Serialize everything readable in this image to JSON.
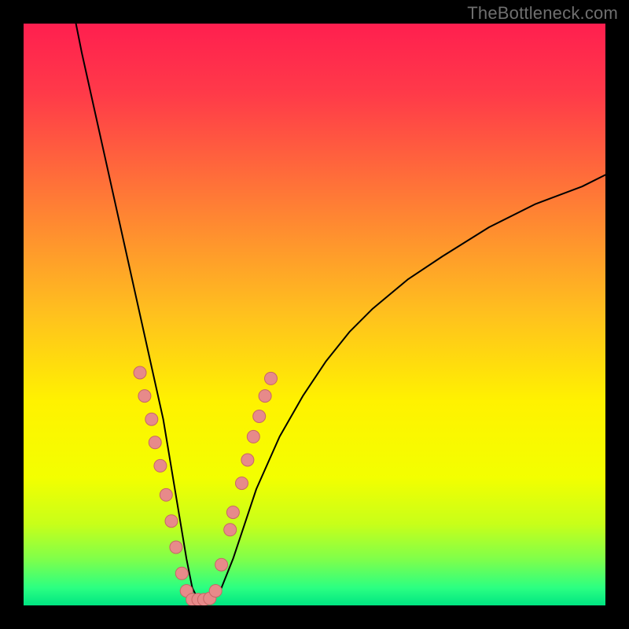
{
  "watermark": "TheBottleneck.com",
  "chart_data": {
    "type": "line",
    "title": "",
    "xlabel": "",
    "ylabel": "",
    "xlim": [
      0,
      100
    ],
    "ylim": [
      0,
      100
    ],
    "grid": false,
    "legend": false,
    "background_gradient": {
      "stops": [
        {
          "offset": 0.0,
          "color": "#ff1f4f"
        },
        {
          "offset": 0.12,
          "color": "#ff3a49"
        },
        {
          "offset": 0.3,
          "color": "#ff7a36"
        },
        {
          "offset": 0.5,
          "color": "#ffc11e"
        },
        {
          "offset": 0.65,
          "color": "#fff200"
        },
        {
          "offset": 0.78,
          "color": "#f3ff00"
        },
        {
          "offset": 0.86,
          "color": "#c8ff19"
        },
        {
          "offset": 0.92,
          "color": "#80ff4a"
        },
        {
          "offset": 0.97,
          "color": "#2bff82"
        },
        {
          "offset": 1.0,
          "color": "#00e582"
        }
      ]
    },
    "series": [
      {
        "name": "bottleneck-curve",
        "stroke": "#000000",
        "stroke_width": 2,
        "x": [
          9,
          10,
          12,
          14,
          16,
          18,
          20,
          22,
          24,
          25,
          26,
          27,
          28,
          29,
          30,
          32,
          34,
          36,
          38,
          40,
          44,
          48,
          52,
          56,
          60,
          66,
          72,
          80,
          88,
          96,
          100
        ],
        "y": [
          100,
          95,
          86,
          77,
          68,
          59,
          50,
          41,
          32,
          26,
          20,
          14,
          8,
          3,
          1,
          1,
          3,
          8,
          14,
          20,
          29,
          36,
          42,
          47,
          51,
          56,
          60,
          65,
          69,
          72,
          74
        ]
      }
    ],
    "markers": {
      "name": "highlight-points",
      "fill": "#e78a8a",
      "stroke": "#c76666",
      "radius": 8,
      "points": [
        {
          "x": 20.0,
          "y": 40.0
        },
        {
          "x": 20.8,
          "y": 36.0
        },
        {
          "x": 22.0,
          "y": 32.0
        },
        {
          "x": 22.6,
          "y": 28.0
        },
        {
          "x": 23.5,
          "y": 24.0
        },
        {
          "x": 24.5,
          "y": 19.0
        },
        {
          "x": 25.4,
          "y": 14.5
        },
        {
          "x": 26.2,
          "y": 10.0
        },
        {
          "x": 27.2,
          "y": 5.5
        },
        {
          "x": 28.0,
          "y": 2.5
        },
        {
          "x": 29.0,
          "y": 1.0
        },
        {
          "x": 30.0,
          "y": 1.0
        },
        {
          "x": 31.0,
          "y": 1.0
        },
        {
          "x": 32.0,
          "y": 1.2
        },
        {
          "x": 33.0,
          "y": 2.5
        },
        {
          "x": 34.0,
          "y": 7.0
        },
        {
          "x": 35.5,
          "y": 13.0
        },
        {
          "x": 36.0,
          "y": 16.0
        },
        {
          "x": 37.5,
          "y": 21.0
        },
        {
          "x": 38.5,
          "y": 25.0
        },
        {
          "x": 39.5,
          "y": 29.0
        },
        {
          "x": 40.5,
          "y": 32.5
        },
        {
          "x": 41.5,
          "y": 36.0
        },
        {
          "x": 42.5,
          "y": 39.0
        }
      ]
    }
  }
}
